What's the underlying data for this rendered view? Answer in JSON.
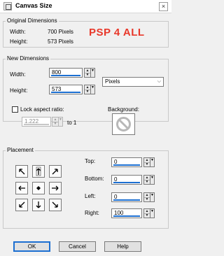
{
  "window": {
    "title": "Canvas Size",
    "close_glyph": "×"
  },
  "original": {
    "legend": "Original Dimensions",
    "width_label": "Width:",
    "width_value": "700 Pixels",
    "height_label": "Height:",
    "height_value": "573 Pixels",
    "brand_text": "PSP 4 ALL"
  },
  "new_dims": {
    "legend": "New Dimensions",
    "width_label": "Width:",
    "width_value": "800",
    "height_label": "Height:",
    "height_value": "573",
    "units_value": "Pixels",
    "lock_label": "Lock aspect ratio:",
    "lock_checked": false,
    "ratio_value": "1.222",
    "to_label": "to 1",
    "background_label": "Background:"
  },
  "placement": {
    "legend": "Placement",
    "anchors": [
      "top-left",
      "top",
      "top-right",
      "left",
      "center",
      "right",
      "bottom-left",
      "bottom",
      "bottom-right"
    ],
    "top_label": "Top:",
    "top_value": "0",
    "bottom_label": "Bottom:",
    "bottom_value": "0",
    "left_label": "Left:",
    "left_value": "0",
    "right_label": "Right:",
    "right_value": "100"
  },
  "buttons": {
    "ok": "OK",
    "cancel": "Cancel",
    "help": "Help"
  },
  "colors": {
    "accent": "#1c6fd1",
    "brand": "#e8382a"
  }
}
